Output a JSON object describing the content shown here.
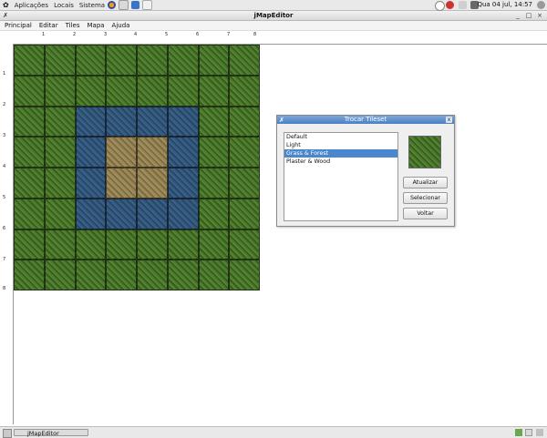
{
  "top_panel": {
    "menus": [
      "Aplicações",
      "Locais",
      "Sistema"
    ],
    "launcher_icons": [
      "firefox-icon",
      "mail-icon",
      "help-icon",
      "notes-icon"
    ],
    "tray_icons": [
      "network-icon",
      "update-icon",
      "volume-icon",
      "battery-icon"
    ],
    "clock": "Qua 04 jul, 14:57"
  },
  "window": {
    "title": "jMapEditor",
    "menu": [
      "Principal",
      "Editar",
      "Tiles",
      "Mapa",
      "Ajuda"
    ]
  },
  "rulers": {
    "top_labels": [
      "1",
      "2",
      "3",
      "4",
      "5",
      "6",
      "7",
      "8"
    ],
    "left_labels": [
      "1",
      "2",
      "3",
      "4",
      "5",
      "6",
      "7",
      "8"
    ]
  },
  "map": {
    "rows": 8,
    "cols": 8,
    "tiles": [
      "gggggggg",
      "gggggggg",
      "ggwwwwgg",
      "ggwddwgg",
      "ggwddwgg",
      "ggwwwwgg",
      "gggggggg",
      "gggggggg"
    ],
    "colors": {
      "grass": "#3f6a25",
      "water": "#2f5278",
      "dirt": "#8c7a4e"
    }
  },
  "dialog": {
    "title": "Trocar Tileset",
    "close_glyph": "x",
    "app_glyph": "✗",
    "tilesets": [
      "Default",
      "Light",
      "Grass & Forest",
      "Plaster & Wood"
    ],
    "selected_index": 2,
    "buttons": {
      "refresh": "Atualizar",
      "select": "Selecionar",
      "back": "Voltar"
    }
  },
  "bottom_panel": {
    "taskbar_label": "jMapEditor"
  },
  "colors": {
    "accent": "#4a87cc",
    "selection": "#4a87cc"
  }
}
